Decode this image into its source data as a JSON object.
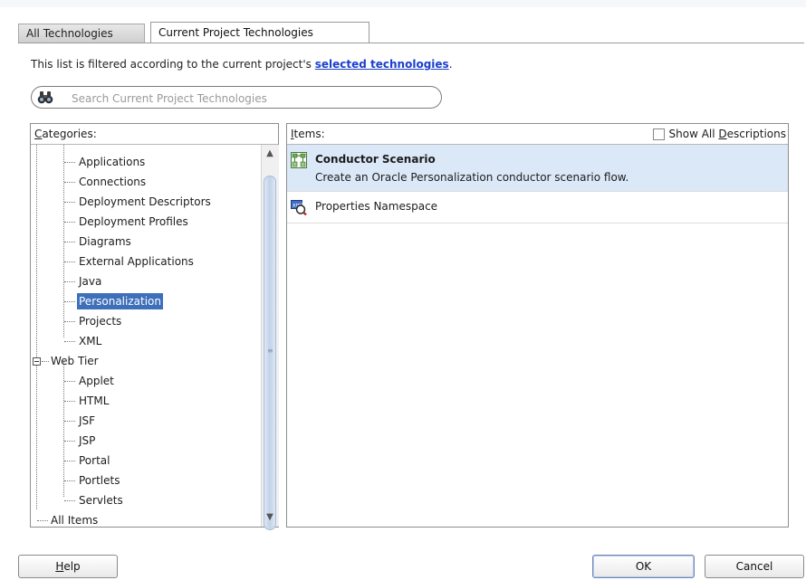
{
  "tabs": [
    {
      "label": "All Technologies",
      "active": false
    },
    {
      "label": "Current Project Technologies",
      "active": true
    }
  ],
  "filter_note": {
    "prefix": "This list is filtered according to the current project's ",
    "link": "selected technologies",
    "suffix": "."
  },
  "search": {
    "placeholder": "Search Current Project Technologies",
    "value": ""
  },
  "categories": {
    "header_mnemonic": "C",
    "header_rest": "ategories:",
    "items": [
      {
        "label": "Applications"
      },
      {
        "label": "Connections"
      },
      {
        "label": "Deployment Descriptors"
      },
      {
        "label": "Deployment Profiles"
      },
      {
        "label": "Diagrams"
      },
      {
        "label": "External Applications"
      },
      {
        "label": "Java"
      },
      {
        "label": "Personalization",
        "selected": true
      },
      {
        "label": "Projects"
      },
      {
        "label": "XML"
      },
      {
        "label": "Web Tier",
        "expanded": true
      },
      {
        "label": "Applet"
      },
      {
        "label": "HTML"
      },
      {
        "label": "JSF"
      },
      {
        "label": "JSP"
      },
      {
        "label": "Portal"
      },
      {
        "label": "Portlets"
      },
      {
        "label": "Servlets"
      },
      {
        "label": "All Items"
      }
    ]
  },
  "items_panel": {
    "header_mnemonic": "I",
    "header_rest": "tems:",
    "show_desc_prefix": "Show All ",
    "show_desc_mnemonic": "D",
    "show_desc_rest": "escriptions",
    "show_desc_checked": false,
    "items": [
      {
        "title": "Conductor Scenario",
        "description": "Create an Oracle Personalization conductor scenario flow.",
        "selected": true,
        "icon": "conductor-scenario-icon"
      },
      {
        "title": "Properties Namespace",
        "selected": false,
        "icon": "properties-namespace-icon"
      }
    ]
  },
  "buttons": {
    "help_mnemonic": "H",
    "help_rest": "elp",
    "ok": "OK",
    "cancel": "Cancel"
  },
  "colors": {
    "selection": "#3d6fba",
    "item_selection": "#dbe8f7",
    "link": "#1a3fcc"
  }
}
